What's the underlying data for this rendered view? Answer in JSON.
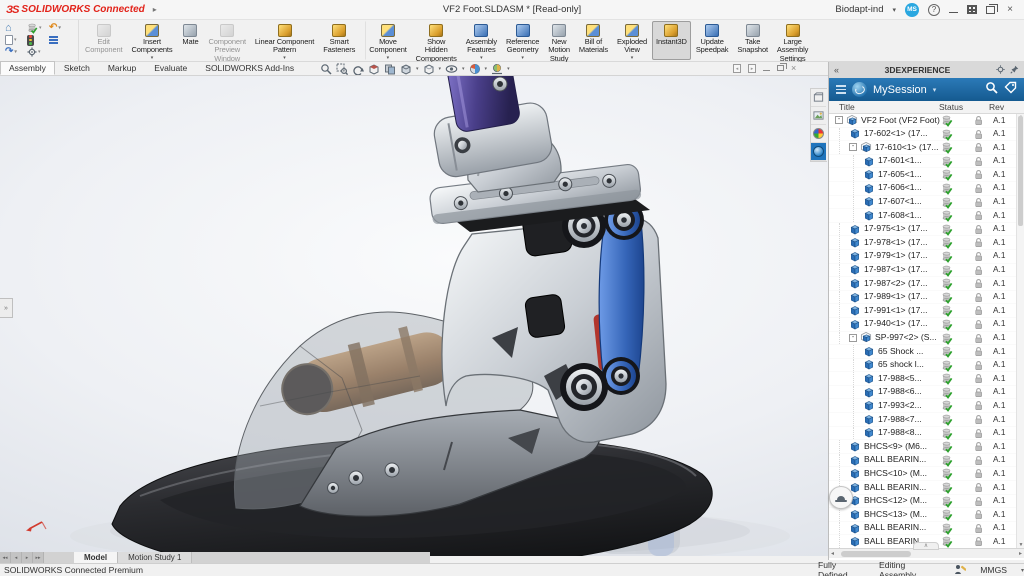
{
  "icons": {
    "logo_mark": "ЗS",
    "expand_arrow": "▸",
    "caret_down": "▾",
    "collapse_left": "«",
    "scroll_up": "▲",
    "scroll_down": "▼",
    "scroll_left": "◂",
    "scroll_right": "▸",
    "handle_up": "∧",
    "nav_first": "◂◂",
    "nav_prev": "◂",
    "nav_next": "▸",
    "nav_last": "▸▸"
  },
  "window": {
    "brand": "SOLIDWORKS Connected",
    "doc_title": "VF2 Foot.SLDASM * [Read-only]",
    "account": "Biodapt-ind",
    "avatar": "MS",
    "help": "?"
  },
  "ribbon": {
    "buttons": [
      {
        "label": "Edit\nComponent",
        "state": "disabled",
        "caret": "",
        "ic": "gray"
      },
      {
        "label": "Insert\nComponents",
        "state": "",
        "caret": "▾",
        "ic": "goldblue"
      },
      {
        "label": "Mate",
        "state": "",
        "caret": "",
        "ic": "gray2"
      },
      {
        "label": "Component\nPreview\nWindow",
        "state": "disabled",
        "caret": "",
        "ic": "gray"
      },
      {
        "label": "Linear Component\nPattern",
        "state": "",
        "caret": "▾",
        "ic": "gold"
      },
      {
        "label": "Smart\nFasteners",
        "state": "",
        "caret": "",
        "ic": "gold"
      },
      {
        "label": "Move\nComponent",
        "state": "",
        "caret": "▾",
        "ic": "goldblue"
      },
      {
        "label": "Show\nHidden\nComponents",
        "state": "",
        "caret": "",
        "ic": "gold"
      },
      {
        "label": "Assembly\nFeatures",
        "state": "",
        "caret": "▾",
        "ic": "blue"
      },
      {
        "label": "Reference\nGeometry",
        "state": "",
        "caret": "▾",
        "ic": "blue"
      },
      {
        "label": "New\nMotion\nStudy",
        "state": "",
        "caret": "",
        "ic": "gray2"
      },
      {
        "label": "Bill of\nMaterials",
        "state": "",
        "caret": "",
        "ic": "goldblue"
      },
      {
        "label": "Exploded\nView",
        "state": "",
        "caret": "▾",
        "ic": "goldblue"
      },
      {
        "label": "Instant3D",
        "state": "active",
        "caret": "",
        "ic": "gold"
      },
      {
        "label": "Update\nSpeedpak",
        "state": "",
        "caret": "",
        "ic": "blue"
      },
      {
        "label": "Take\nSnapshot",
        "state": "",
        "caret": "",
        "ic": "gray2"
      },
      {
        "label": "Large\nAssembly\nSettings",
        "state": "",
        "caret": "",
        "ic": "gold"
      }
    ]
  },
  "tabs": {
    "items": [
      {
        "label": "Assembly",
        "state": "active"
      },
      {
        "label": "Sketch",
        "state": ""
      },
      {
        "label": "Markup",
        "state": ""
      },
      {
        "label": "Evaluate",
        "state": ""
      },
      {
        "label": "SOLIDWORKS Add-Ins",
        "state": ""
      }
    ]
  },
  "panel": {
    "title": "3DEXPERIENCE",
    "session": "MySession",
    "col_title": "Title",
    "col_status": "Status",
    "col_rev": "Rev",
    "rows": [
      {
        "label": "VF2 Foot (VF2 Foot)",
        "depth": 0,
        "type": "assy",
        "exp": "-",
        "rev": "A.1"
      },
      {
        "label": "17-602<1> (17...",
        "depth": 1,
        "type": "part",
        "exp": "",
        "rev": "A.1"
      },
      {
        "label": "17-610<1> (17...",
        "depth": 1,
        "type": "assy",
        "exp": "-",
        "rev": "A.1"
      },
      {
        "label": "17-601<1...",
        "depth": 2,
        "type": "part",
        "exp": "",
        "rev": "A.1"
      },
      {
        "label": "17-605<1...",
        "depth": 2,
        "type": "part",
        "exp": "",
        "rev": "A.1"
      },
      {
        "label": "17-606<1...",
        "depth": 2,
        "type": "part",
        "exp": "",
        "rev": "A.1"
      },
      {
        "label": "17-607<1...",
        "depth": 2,
        "type": "part",
        "exp": "",
        "rev": "A.1"
      },
      {
        "label": "17-608<1...",
        "depth": 2,
        "type": "part",
        "exp": "",
        "rev": "A.1"
      },
      {
        "label": "17-975<1> (17...",
        "depth": 1,
        "type": "part",
        "exp": "",
        "rev": "A.1"
      },
      {
        "label": "17-978<1> (17...",
        "depth": 1,
        "type": "part",
        "exp": "",
        "rev": "A.1"
      },
      {
        "label": "17-979<1> (17...",
        "depth": 1,
        "type": "part",
        "exp": "",
        "rev": "A.1"
      },
      {
        "label": "17-987<1> (17...",
        "depth": 1,
        "type": "part",
        "exp": "",
        "rev": "A.1"
      },
      {
        "label": "17-987<2> (17...",
        "depth": 1,
        "type": "part",
        "exp": "",
        "rev": "A.1"
      },
      {
        "label": "17-989<1> (17...",
        "depth": 1,
        "type": "part",
        "exp": "",
        "rev": "A.1"
      },
      {
        "label": "17-991<1> (17...",
        "depth": 1,
        "type": "part",
        "exp": "",
        "rev": "A.1"
      },
      {
        "label": "17-940<1> (17...",
        "depth": 1,
        "type": "part",
        "exp": "",
        "rev": "A.1"
      },
      {
        "label": "SP-997<2> (S...",
        "depth": 1,
        "type": "assy",
        "exp": "-",
        "rev": "A.1"
      },
      {
        "label": "65 Shock ...",
        "depth": 2,
        "type": "part",
        "exp": "",
        "rev": "A.1"
      },
      {
        "label": "65 shock l...",
        "depth": 2,
        "type": "part",
        "exp": "",
        "rev": "A.1"
      },
      {
        "label": "17-988<5...",
        "depth": 2,
        "type": "part",
        "exp": "",
        "rev": "A.1"
      },
      {
        "label": "17-988<6...",
        "depth": 2,
        "type": "part",
        "exp": "",
        "rev": "A.1"
      },
      {
        "label": "17-993<2...",
        "depth": 2,
        "type": "part",
        "exp": "",
        "rev": "A.1"
      },
      {
        "label": "17-988<7...",
        "depth": 2,
        "type": "part",
        "exp": "",
        "rev": "A.1"
      },
      {
        "label": "17-988<8...",
        "depth": 2,
        "type": "part",
        "exp": "",
        "rev": "A.1"
      },
      {
        "label": "BHCS<9> (M6...",
        "depth": 1,
        "type": "part",
        "exp": "",
        "rev": "A.1"
      },
      {
        "label": "BALL BEARIN...",
        "depth": 1,
        "type": "part",
        "exp": "",
        "rev": "A.1"
      },
      {
        "label": "BHCS<10> (M...",
        "depth": 1,
        "type": "part",
        "exp": "",
        "rev": "A.1"
      },
      {
        "label": "BALL BEARIN...",
        "depth": 1,
        "type": "part",
        "exp": "",
        "rev": "A.1"
      },
      {
        "label": "BHCS<12> (M...",
        "depth": 1,
        "type": "part",
        "exp": "",
        "rev": "A.1"
      },
      {
        "label": "BHCS<13> (M...",
        "depth": 1,
        "type": "part",
        "exp": "",
        "rev": "A.1"
      },
      {
        "label": "BALL BEARIN...",
        "depth": 1,
        "type": "part",
        "exp": "",
        "rev": "A.1"
      },
      {
        "label": "BALL BEARIN...",
        "depth": 1,
        "type": "part",
        "exp": "",
        "rev": "A.1"
      }
    ]
  },
  "model_tabs": {
    "model": "Model",
    "motion": "Motion Study 1"
  },
  "status_bar": {
    "product": "SOLIDWORKS Connected Premium",
    "defined": "Fully Defined",
    "mode": "Editing Assembly",
    "units": "MMGS"
  }
}
